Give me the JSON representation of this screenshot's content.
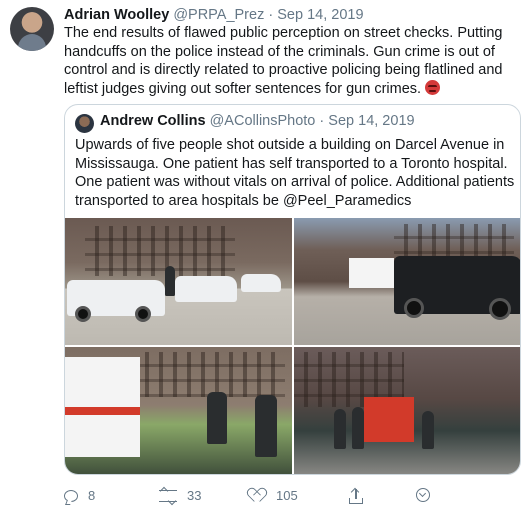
{
  "tweet": {
    "author_name": "Adrian Woolley",
    "author_handle": "@PRPA_Prez",
    "separator": "·",
    "date": "Sep 14, 2019",
    "text": "The end results of flawed public perception on street checks. Putting handcuffs on the police instead of the criminals. Gun crime is out of control and is directly related to proactive policing being flatlined and leftist judges giving out softer sentences for gun crimes.",
    "emoji_icon": "angry-face-icon"
  },
  "quoted_tweet": {
    "author_name": "Andrew Collins",
    "author_handle": "@ACollinsPhoto",
    "separator": "·",
    "date": "Sep 14, 2019",
    "text": "Upwards of five people shot outside a building on Darcel Avenue in Mississauga. One patient has self transported to a Toronto hospital. One patient was without vitals on arrival of police. Additional patients transported to area hospitals be @Peel_Paramedics"
  },
  "actions": {
    "replies": "8",
    "retweets": "33",
    "likes": "105"
  },
  "colors": {
    "text": "#14171a",
    "secondary": "#657786",
    "border": "#ccd6dd"
  }
}
